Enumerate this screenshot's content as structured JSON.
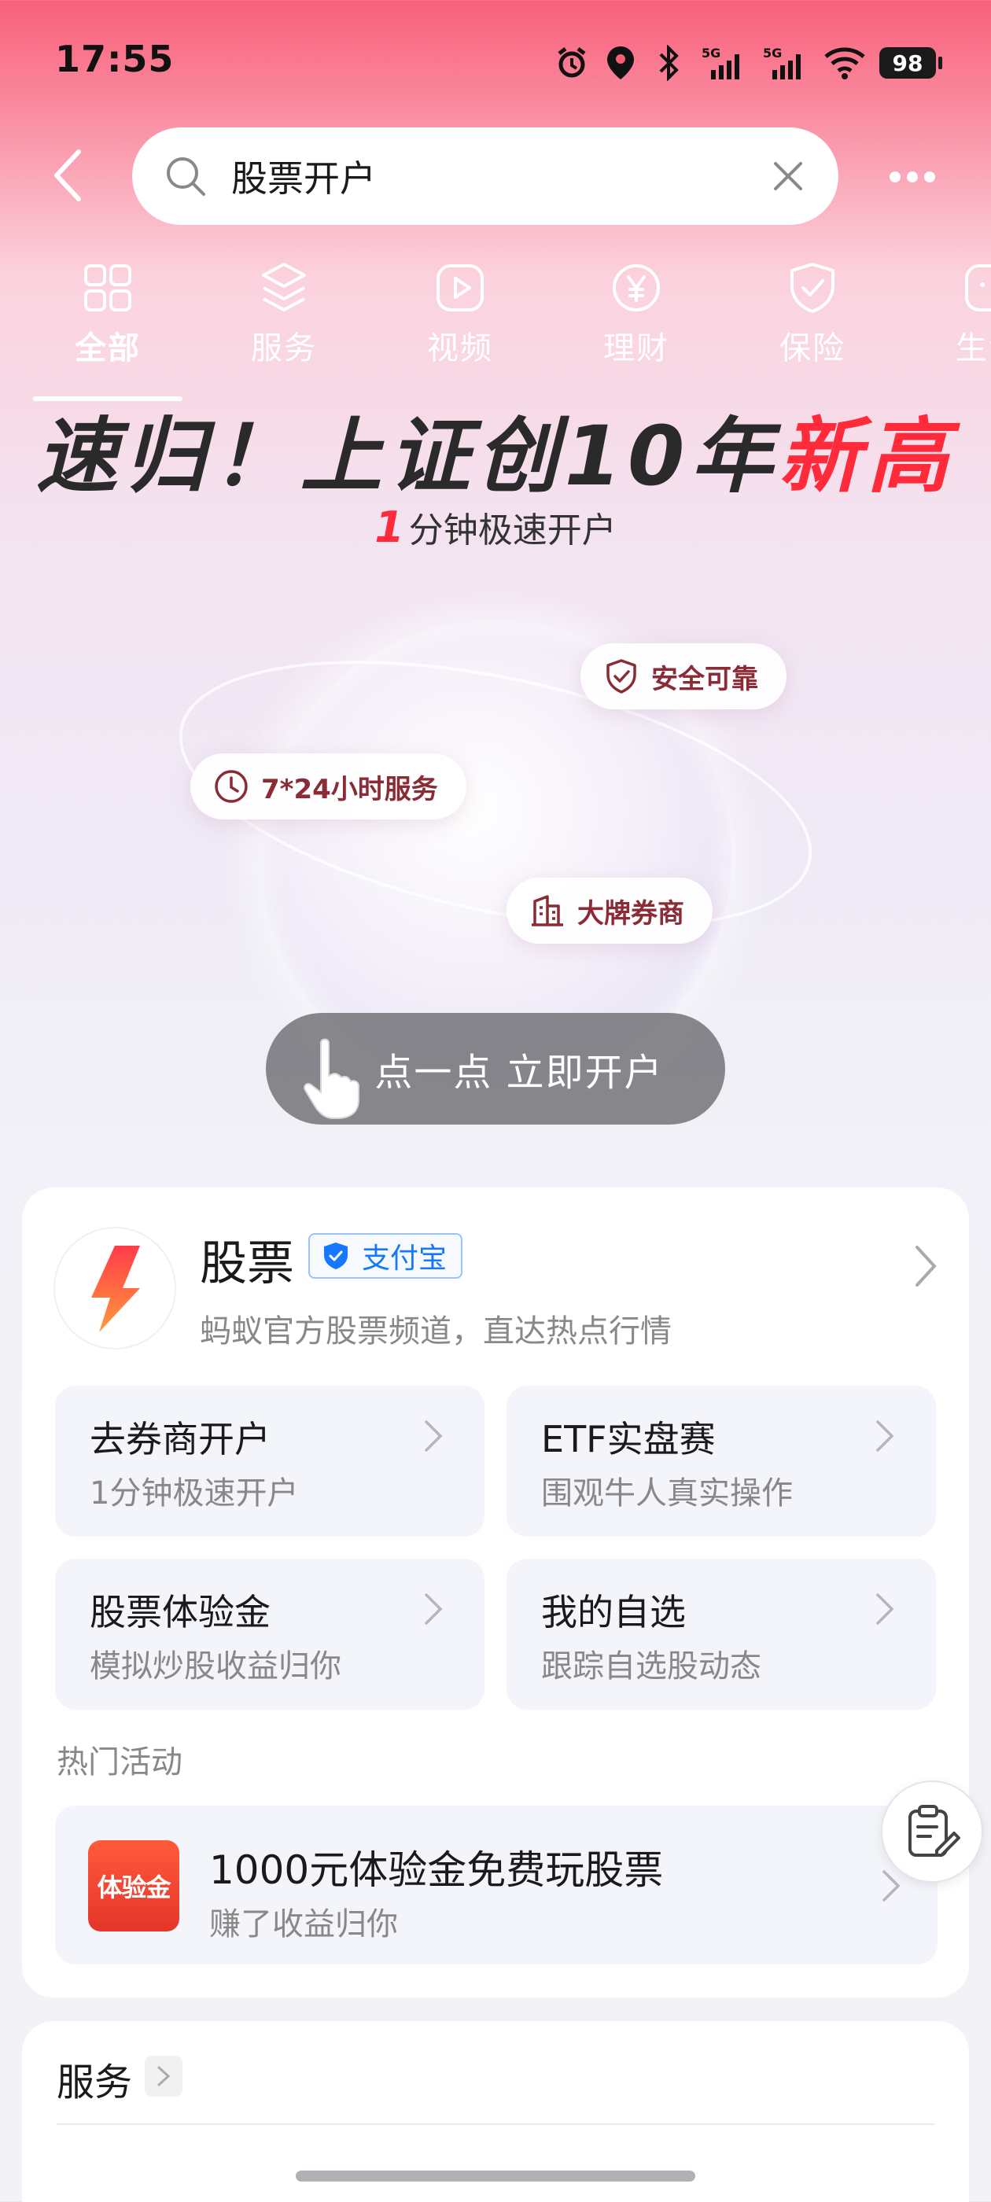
{
  "status_bar": {
    "time": "17:55",
    "network_1": "5G",
    "network_2": "5G",
    "battery": "98"
  },
  "search": {
    "query": "股票开户"
  },
  "tabs": [
    {
      "label": "全部",
      "icon": "grid-icon",
      "active": true
    },
    {
      "label": "服务",
      "icon": "layers-icon"
    },
    {
      "label": "视频",
      "icon": "play-icon"
    },
    {
      "label": "理财",
      "icon": "yen-icon"
    },
    {
      "label": "保险",
      "icon": "shield-check-icon"
    },
    {
      "label": "生活",
      "icon": "life-icon"
    }
  ],
  "hero": {
    "title_prefix": "速归！上证创10年",
    "title_highlight": "新高",
    "subtitle_num": "1",
    "subtitle_text": "分钟极速开户",
    "features": [
      {
        "label": "安全可靠",
        "icon": "shield-check-icon"
      },
      {
        "label": "7*24小时服务",
        "icon": "clock-icon"
      },
      {
        "label": "大牌券商",
        "icon": "building-icon"
      }
    ],
    "cta_label": "点一点 立即开户"
  },
  "stock_card": {
    "title": "股票",
    "badge": "支付宝",
    "description": "蚂蚁官方股票频道，直达热点行情",
    "tiles": [
      {
        "title": "去券商开户",
        "subtitle": "1分钟极速开户"
      },
      {
        "title": "ETF实盘赛",
        "subtitle": "围观牛人真实操作"
      },
      {
        "title": "股票体验金",
        "subtitle": "模拟炒股收益归你"
      },
      {
        "title": "我的自选",
        "subtitle": "跟踪自选股动态"
      }
    ],
    "hot_label": "热门活动",
    "activity": {
      "logo_text": "体验金",
      "title": "1000元体验金免费玩股票",
      "subtitle": "赚了收益归你"
    }
  },
  "services": {
    "title": "服务"
  },
  "colors": {
    "accent_red": "#ff2b3a",
    "badge_blue": "#1677ff",
    "pill_text": "#8a2b35"
  }
}
